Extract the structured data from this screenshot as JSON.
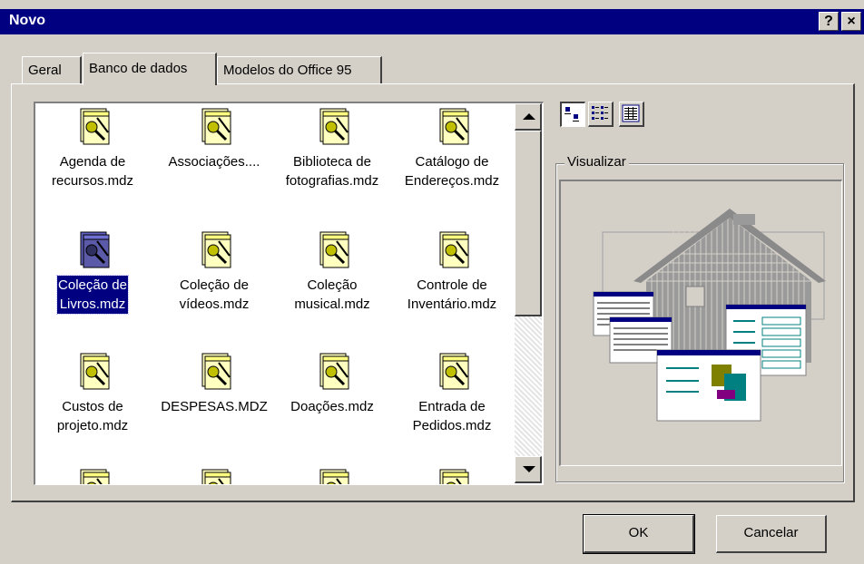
{
  "window": {
    "title": "Novo",
    "help_label": "?",
    "close_label": "×"
  },
  "tabs": [
    {
      "label": "Geral"
    },
    {
      "label": "Banco de dados"
    },
    {
      "label": "Modelos do Office 95"
    }
  ],
  "items": [
    {
      "label": "Agenda de recursos.mdz",
      "lines": [
        "Agenda de",
        "recursos.mdz"
      ]
    },
    {
      "label": "Associações....",
      "lines": [
        "Associações...."
      ]
    },
    {
      "label": "Biblioteca de fotografias.mdz",
      "lines": [
        "Biblioteca de",
        "fotografias.mdz"
      ]
    },
    {
      "label": "Catálogo de Endereços.mdz",
      "lines": [
        "Catálogo de",
        "Endereços.mdz"
      ]
    },
    {
      "label": "Coleção de Livros.mdz",
      "lines": [
        "Coleção de",
        "Livros.mdz"
      ],
      "selected": true
    },
    {
      "label": "Coleção de vídeos.mdz",
      "lines": [
        "Coleção de",
        "vídeos.mdz"
      ]
    },
    {
      "label": "Coleção musical.mdz",
      "lines": [
        "Coleção",
        "musical.mdz"
      ]
    },
    {
      "label": "Controle de Inventário.mdz",
      "lines": [
        "Controle de",
        "Inventário.mdz"
      ]
    },
    {
      "label": "Custos de projeto.mdz",
      "lines": [
        "Custos de",
        "projeto.mdz"
      ]
    },
    {
      "label": "DESPESAS.MDZ",
      "lines": [
        "DESPESAS.MDZ"
      ]
    },
    {
      "label": "Doações.mdz",
      "lines": [
        "Doações.mdz"
      ]
    },
    {
      "label": "Entrada de Pedidos.mdz",
      "lines": [
        "Entrada de",
        "Pedidos.mdz"
      ]
    }
  ],
  "preview": {
    "label": "Visualizar"
  },
  "view_buttons": [
    {
      "icon": "large-icons-view-icon",
      "pressed": true
    },
    {
      "icon": "list-view-icon",
      "pressed": false
    },
    {
      "icon": "details-view-icon",
      "pressed": false
    }
  ],
  "buttons": {
    "ok": "OK",
    "cancel": "Cancelar"
  },
  "colors": {
    "titlebar": "#000080",
    "face": "#d4d0c8",
    "selection": "#000080"
  }
}
